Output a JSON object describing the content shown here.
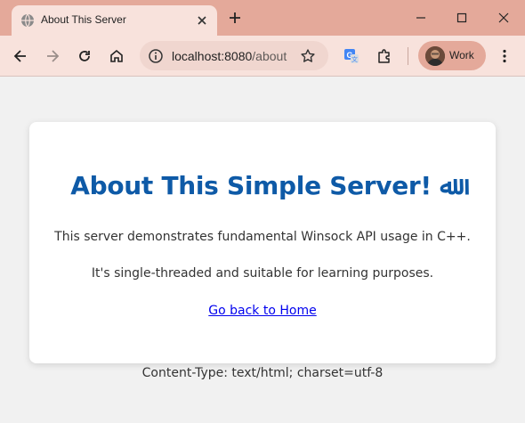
{
  "browser": {
    "tab": {
      "title": "About This Server"
    },
    "address_bar": {
      "host": "localhost:8080",
      "path": "/about"
    },
    "profile": {
      "name": "Work"
    },
    "colors": {
      "frame": "#e4a99a",
      "toolbar": "#f8e2dc"
    }
  },
  "page": {
    "heading": "About This Simple Server! ﷲ",
    "paragraph_1": "This server demonstrates fundamental Winsock API usage in C++.",
    "paragraph_2": "It's single-threaded and suitable for learning purposes.",
    "home_link": "Go back to Home",
    "footer": "Content-Type: text/html; charset=utf-8",
    "colors": {
      "heading": "#0e5aa7",
      "link": "#0000ee",
      "background": "#f1f1f1"
    }
  }
}
